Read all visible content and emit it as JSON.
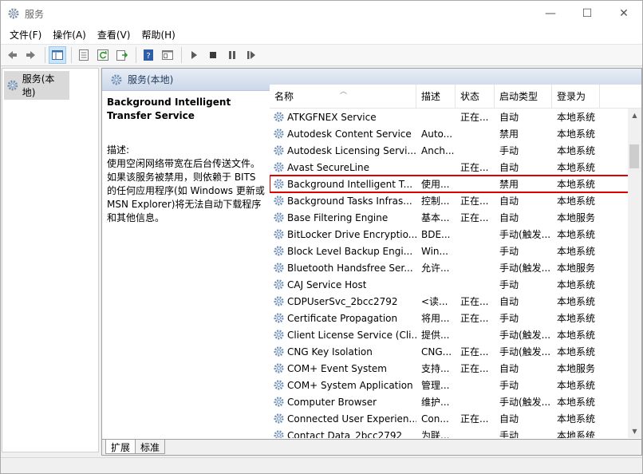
{
  "window": {
    "title": "服务",
    "controls": {
      "minimize": "—",
      "maximize": "☐",
      "close": "✕"
    }
  },
  "menu": [
    {
      "label": "文件(F)"
    },
    {
      "label": "操作(A)"
    },
    {
      "label": "查看(V)"
    },
    {
      "label": "帮助(H)"
    }
  ],
  "toolbar": {
    "icons": [
      "back-arrow-icon",
      "forward-arrow-icon",
      "show-console-tree-icon",
      "properties-icon",
      "refresh-icon",
      "export-list-icon",
      "help-icon",
      "view-icon",
      "start-icon",
      "stop-icon",
      "pause-icon",
      "restart-icon"
    ]
  },
  "tree": {
    "item_label": "服务(本地)"
  },
  "pane": {
    "header_label": "服务(本地)",
    "selected_service_title": "Background Intelligent Transfer Service",
    "desc_label": "描述:",
    "desc_text": "使用空闲网络带宽在后台传送文件。如果该服务被禁用，则依赖于 BITS 的任何应用程序(如 Windows 更新或 MSN Explorer)将无法自动下载程序和其他信息。"
  },
  "columns": {
    "name": "名称",
    "desc": "描述",
    "status": "状态",
    "startup": "启动类型",
    "logon": "登录为"
  },
  "services": [
    {
      "name": "ATKGFNEX Service",
      "desc": "",
      "status": "正在...",
      "startup": "自动",
      "logon": "本地系统"
    },
    {
      "name": "Autodesk Content Service",
      "desc": "Auto...",
      "status": "",
      "startup": "禁用",
      "logon": "本地系统"
    },
    {
      "name": "Autodesk Licensing Servi...",
      "desc": "Anch...",
      "status": "",
      "startup": "手动",
      "logon": "本地系统"
    },
    {
      "name": "Avast SecureLine",
      "desc": "",
      "status": "正在...",
      "startup": "自动",
      "logon": "本地系统"
    },
    {
      "name": "Background Intelligent T...",
      "desc": "使用...",
      "status": "",
      "startup": "禁用",
      "logon": "本地系统",
      "selected": true
    },
    {
      "name": "Background Tasks Infras...",
      "desc": "控制...",
      "status": "正在...",
      "startup": "自动",
      "logon": "本地系统"
    },
    {
      "name": "Base Filtering Engine",
      "desc": "基本...",
      "status": "正在...",
      "startup": "自动",
      "logon": "本地服务"
    },
    {
      "name": "BitLocker Drive Encryptio...",
      "desc": "BDE...",
      "status": "",
      "startup": "手动(触发...",
      "logon": "本地系统"
    },
    {
      "name": "Block Level Backup Engi...",
      "desc": "Win...",
      "status": "",
      "startup": "手动",
      "logon": "本地系统"
    },
    {
      "name": "Bluetooth Handsfree Ser...",
      "desc": "允许...",
      "status": "",
      "startup": "手动(触发...",
      "logon": "本地服务"
    },
    {
      "name": "CAJ Service Host",
      "desc": "",
      "status": "",
      "startup": "手动",
      "logon": "本地系统"
    },
    {
      "name": "CDPUserSvc_2bcc2792",
      "desc": "<读...",
      "status": "正在...",
      "startup": "自动",
      "logon": "本地系统"
    },
    {
      "name": "Certificate Propagation",
      "desc": "将用...",
      "status": "正在...",
      "startup": "手动",
      "logon": "本地系统"
    },
    {
      "name": "Client License Service (Cli...",
      "desc": "提供...",
      "status": "",
      "startup": "手动(触发...",
      "logon": "本地系统"
    },
    {
      "name": "CNG Key Isolation",
      "desc": "CNG...",
      "status": "正在...",
      "startup": "手动(触发...",
      "logon": "本地系统"
    },
    {
      "name": "COM+ Event System",
      "desc": "支持...",
      "status": "正在...",
      "startup": "自动",
      "logon": "本地服务"
    },
    {
      "name": "COM+ System Application",
      "desc": "管理...",
      "status": "",
      "startup": "手动",
      "logon": "本地系统"
    },
    {
      "name": "Computer Browser",
      "desc": "维护...",
      "status": "",
      "startup": "手动(触发...",
      "logon": "本地系统"
    },
    {
      "name": "Connected User Experien...",
      "desc": "Con...",
      "status": "正在...",
      "startup": "自动",
      "logon": "本地系统"
    },
    {
      "name": "Contact Data_2bcc2792",
      "desc": "为联...",
      "status": "",
      "startup": "手动",
      "logon": "本地系统"
    }
  ],
  "tabs": [
    {
      "label": "扩展",
      "active": true
    },
    {
      "label": "标准",
      "active": false
    }
  ],
  "colors": {
    "selection_outline": "#e00000",
    "pane_header": "#cbd7e8",
    "gear": "#6f8fb8"
  }
}
